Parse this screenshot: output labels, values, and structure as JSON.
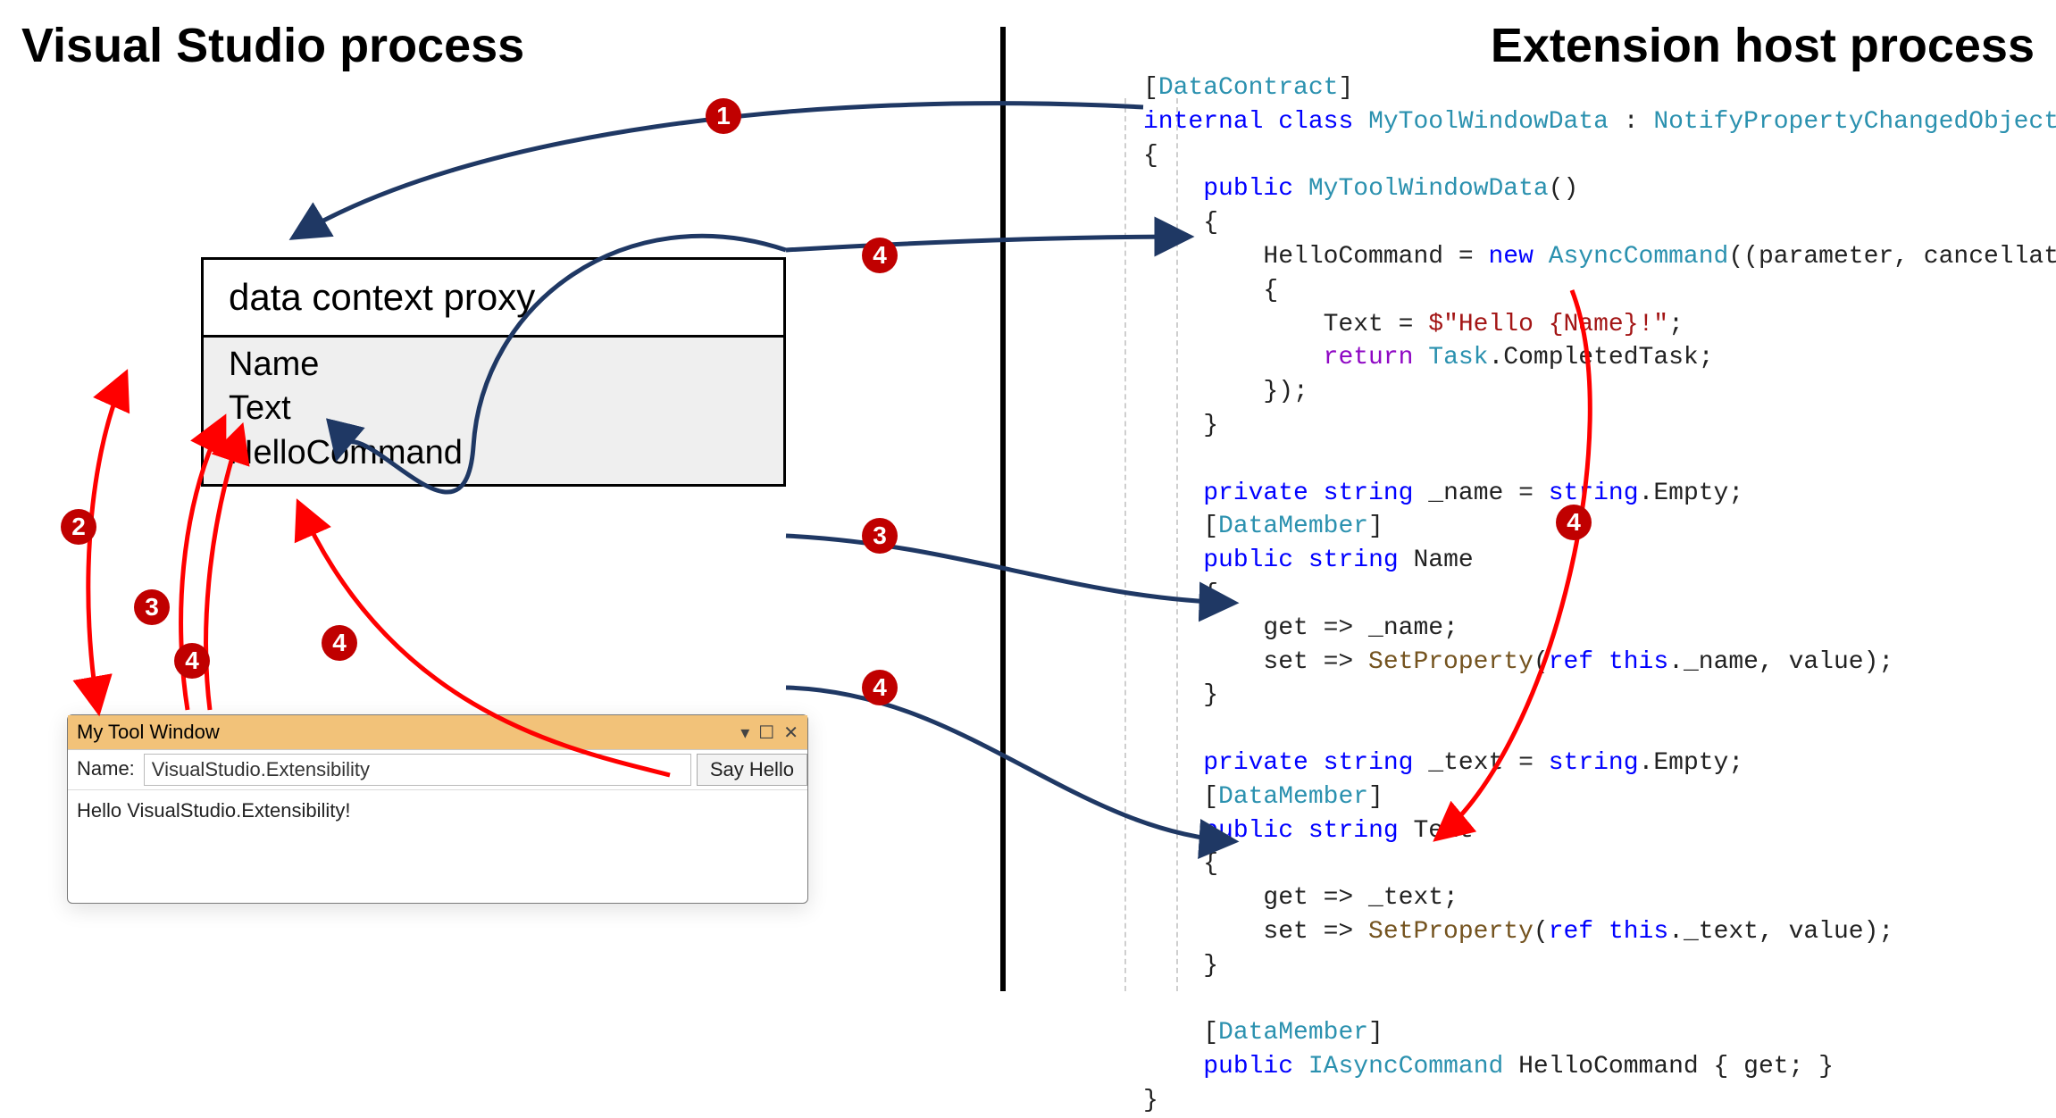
{
  "titles": {
    "left": "Visual Studio process",
    "right": "Extension host process"
  },
  "proxy": {
    "header": "data context proxy",
    "props": [
      "Name",
      "Text",
      "HelloCommand"
    ]
  },
  "toolWindow": {
    "title": "My Tool Window",
    "nameLabel": "Name:",
    "nameValue": "VisualStudio.Extensibility",
    "buttonLabel": "Say Hello",
    "output": "Hello VisualStudio.Extensibility!"
  },
  "badges": {
    "top1": "1",
    "left2": "2",
    "left3": "3",
    "left4_curve": "4",
    "left4": "4",
    "mid4a": "4",
    "mid3": "3",
    "mid4b": "4",
    "right4": "4"
  },
  "code": {
    "attr_DataContract": "DataContract",
    "kw_internal": "internal",
    "kw_class": "class",
    "cls_MyToolWindowData": "MyToolWindowData",
    "colon": " : ",
    "cls_Notify": "NotifyPropertyChangedObject",
    "brace_open": "{",
    "kw_public": "public",
    "ctor_name": "MyToolWindowData",
    "ctor_parens": "()",
    "ctor_brace_open": "    {",
    "assign_HelloCommand": "        HelloCommand = ",
    "kw_new": "new",
    "cls_AsyncCommand": "AsyncCommand",
    "lambda_params": "((parameter, cancellationToken) =>",
    "lambda_brace_open": "        {",
    "text_assign": "            Text = ",
    "str_interp": "$\"Hello {Name}!\"",
    "semi": ";",
    "ret": "            ",
    "kw_return": "return",
    "task": " Task",
    "dot_completed": ".CompletedTask;",
    "lambda_close": "        });",
    "ctor_brace_close": "    }",
    "kw_private": "private",
    "kw_string": "string",
    "fld_name": " _name = ",
    "string_Empty": ".Empty;",
    "string_class": "string",
    "attr_DataMember": "DataMember",
    "prop_Name": " Name",
    "prop_brace_open": "    {",
    "get_arrow": "        get => _name;",
    "set_arrow_pre": "        set => ",
    "SetProperty": "SetProperty",
    "setprop_name_args_pre": "(",
    "kw_ref": "ref",
    "kw_this": "this",
    "setprop_name_args_post": "._name, value);",
    "prop_brace_close": "    }",
    "fld_text": " _text = ",
    "prop_Text": " Text",
    "get_text": "        get => _text;",
    "setprop_text_args_post": "._text, value);",
    "cls_IAsyncCommand": "IAsyncCommand",
    "prop_HelloCommand": " HelloCommand { get; }",
    "brace_close": "}"
  }
}
